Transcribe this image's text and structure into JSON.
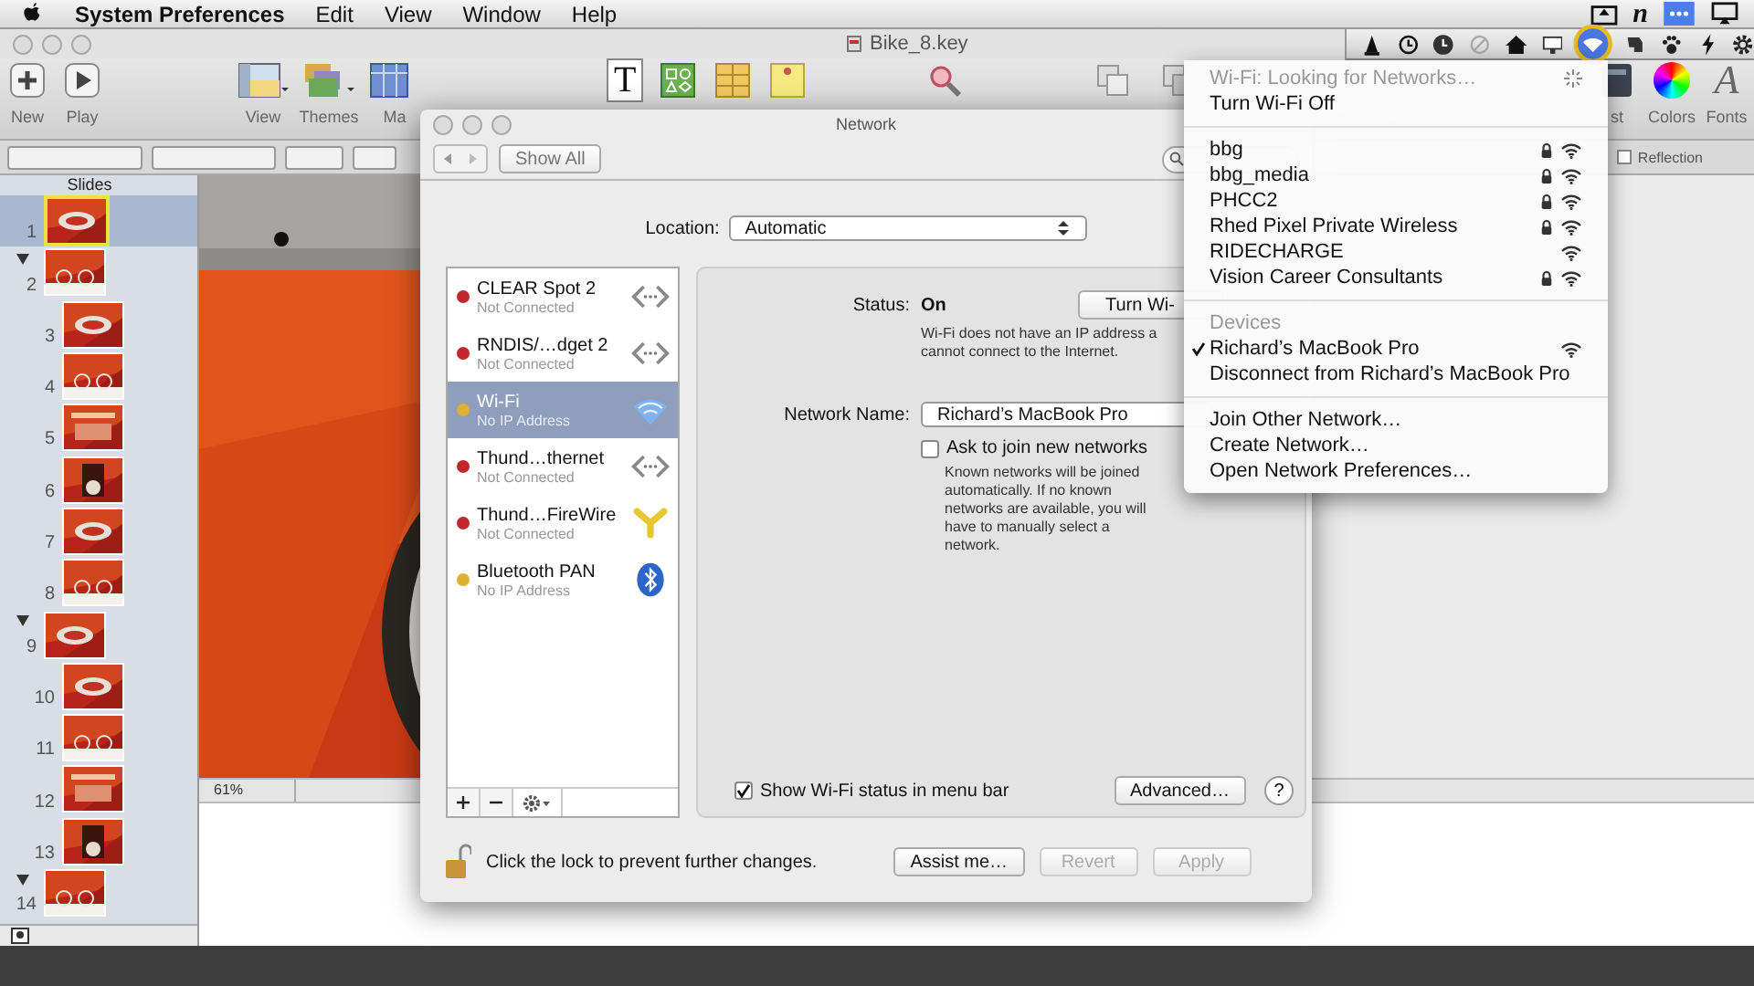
{
  "menu_bar": {
    "app_name": "System Preferences",
    "menus": [
      "Edit",
      "View",
      "Window",
      "Help"
    ],
    "status_icons": [
      {
        "kind": "eject"
      },
      {
        "kind": "glyph",
        "glyph": "n"
      },
      {
        "kind": "dots"
      },
      {
        "kind": "airplay"
      }
    ]
  },
  "keynote": {
    "title": "Bike_8.key",
    "toolbar_left": [
      {
        "label": "New",
        "kind": "new"
      },
      {
        "label": "Play",
        "kind": "play"
      },
      {
        "label": "View",
        "kind": "view"
      },
      {
        "label": "Themes",
        "kind": "themes"
      },
      {
        "label": "Ma",
        "kind": "masters"
      }
    ],
    "toolbar_middle": [
      {
        "kind": "text",
        "glyph": "T"
      },
      {
        "kind": "shapes"
      },
      {
        "kind": "table"
      },
      {
        "kind": "comment"
      },
      {
        "kind": "zoom"
      },
      {
        "kind": "front"
      },
      {
        "kind": "back"
      }
    ],
    "toolbar_right": [
      {
        "label": "st",
        "kind": "inspector"
      },
      {
        "label": "Colors",
        "kind": "colors"
      },
      {
        "label": "Fonts",
        "kind": "fonts",
        "glyph": "A"
      }
    ],
    "reflection": {
      "label": "Reflection",
      "checked": false
    },
    "slides_title": "Slides",
    "slides": [
      {
        "number": "1",
        "selected": true
      },
      {
        "number": "2",
        "selected": false,
        "expanded": true,
        "children": [
          {
            "number": "3",
            "selected": false
          },
          {
            "number": "4",
            "selected": false
          },
          {
            "number": "5",
            "selected": false
          },
          {
            "number": "6",
            "selected": false
          },
          {
            "number": "7",
            "selected": false
          },
          {
            "number": "8",
            "selected": false
          }
        ]
      },
      {
        "number": "9",
        "selected": false,
        "expanded": true,
        "children": [
          {
            "number": "10",
            "selected": false
          },
          {
            "number": "11",
            "selected": false
          },
          {
            "number": "12",
            "selected": false
          },
          {
            "number": "13",
            "selected": false
          }
        ]
      },
      {
        "number": "14",
        "selected": false,
        "expanded": true
      }
    ],
    "zoom": "61%"
  },
  "network": {
    "title": "Network",
    "show_all": "Show All",
    "location_label": "Location:",
    "location": "Automatic",
    "services": [
      {
        "name": "CLEAR Spot 2",
        "status": "Not Connected",
        "color": "#c0282d",
        "kind": "ethernet",
        "selected": false
      },
      {
        "name": "RNDIS/…dget 2",
        "status": "Not Connected",
        "color": "#c0282d",
        "kind": "ethernet",
        "selected": false
      },
      {
        "name": "Wi-Fi",
        "status": "No IP Address",
        "color": "#e0b030",
        "kind": "wifi",
        "selected": true
      },
      {
        "name": "Thund…thernet",
        "status": "Not Connected",
        "color": "#c0282d",
        "kind": "ethernet",
        "selected": false
      },
      {
        "name": "Thund…FireWire",
        "status": "Not Connected",
        "color": "#c0282d",
        "kind": "firewire",
        "selected": false
      },
      {
        "name": "Bluetooth PAN",
        "status": "No IP Address",
        "color": "#e0b030",
        "kind": "bluetooth",
        "selected": false
      }
    ],
    "status_label": "Status:",
    "status_value": "On",
    "turn_off_button": "Turn Wi-",
    "status_note": [
      "Wi-Fi does not have an IP address a",
      "cannot connect to the Internet."
    ],
    "network_name_label": "Network Name:",
    "network_name": "Richard’s MacBook Pro",
    "ask_to_join": {
      "label": "Ask to join new networks",
      "checked": false
    },
    "ask_note": "Known networks will be joined automatically. If no known networks are available, you will have to manually select a network.",
    "show_status": {
      "label": "Show Wi-Fi status in menu bar",
      "checked": true
    },
    "advanced": "Advanced…",
    "help": "?",
    "lock_text": "Click the lock to prevent further changes.",
    "buttons": [
      {
        "label": "Assist me…",
        "disabled": false
      },
      {
        "label": "Revert",
        "disabled": true
      },
      {
        "label": "Apply",
        "disabled": true
      }
    ]
  },
  "wifi_menu": {
    "status": "Wi-Fi: Looking for Networks…",
    "toggle": "Turn Wi-Fi Off",
    "networks": [
      {
        "name": "bbg",
        "locked": true
      },
      {
        "name": "bbg_media",
        "locked": true
      },
      {
        "name": "PHCC2",
        "locked": true
      },
      {
        "name": "Rhed Pixel Private Wireless",
        "locked": true
      },
      {
        "name": "RIDECHARGE",
        "locked": false
      },
      {
        "name": "Vision Career Consultants",
        "locked": true
      }
    ],
    "devices_header": "Devices",
    "devices": [
      {
        "name": "Richard’s MacBook Pro",
        "checked": true
      }
    ],
    "disconnect": "Disconnect from Richard’s MacBook Pro",
    "actions": [
      "Join Other Network…",
      "Create Network…",
      "Open Network Preferences…"
    ]
  }
}
